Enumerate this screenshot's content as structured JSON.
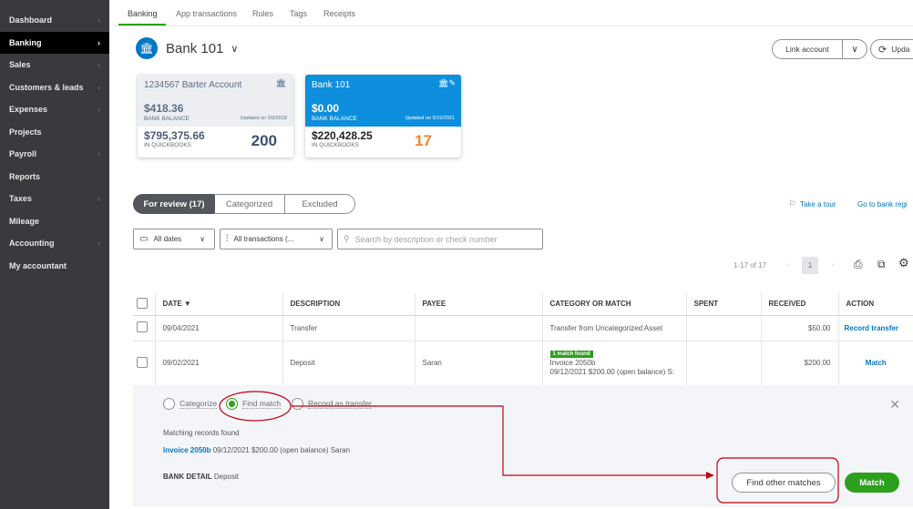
{
  "sidebar": {
    "items": [
      {
        "label": "Dashboard",
        "chevron": true
      },
      {
        "label": "Banking",
        "chevron": true,
        "active": true
      },
      {
        "label": "Sales",
        "chevron": true
      },
      {
        "label": "Customers & leads",
        "chevron": true
      },
      {
        "label": "Expenses",
        "chevron": true
      },
      {
        "label": "Projects",
        "chevron": false
      },
      {
        "label": "Payroll",
        "chevron": true
      },
      {
        "label": "Reports",
        "chevron": false
      },
      {
        "label": "Taxes",
        "chevron": true
      },
      {
        "label": "Mileage",
        "chevron": false
      },
      {
        "label": "Accounting",
        "chevron": true
      },
      {
        "label": "My accountant",
        "chevron": false
      }
    ]
  },
  "tabs": [
    "Banking",
    "App transactions",
    "Rules",
    "Tags",
    "Receipts"
  ],
  "account": {
    "name": "Bank 101"
  },
  "header_buttons": {
    "link_account": "Link account",
    "update": "Upda"
  },
  "cards": [
    {
      "name": "1234567 Barter Account",
      "bank_balance": "$418.36",
      "bank_balance_label": "BANK BALANCE",
      "updated": "Updated on 3/3/2018",
      "qb_balance": "$795,375.66",
      "qb_label": "IN QUICKBOOKS",
      "count": "200"
    },
    {
      "name": "Bank 101",
      "bank_balance": "$0.00",
      "bank_balance_label": "BANK BALANCE",
      "updated": "Updated on 9/19/2021",
      "qb_balance": "$220,428.25",
      "qb_label": "IN QUICKBOOKS",
      "count": "17"
    }
  ],
  "review_tabs": [
    "For review (17)",
    "Categorized",
    "Excluded"
  ],
  "links": {
    "tour": "Take a tour",
    "register": "Go to bank regi"
  },
  "filters": {
    "dates": "All dates",
    "transactions": "All transactions (...",
    "search_placeholder": "Search by description or check number"
  },
  "pagination": {
    "range": "1-17 of 17",
    "page": "1"
  },
  "table": {
    "headers": [
      "DATE ▼",
      "DESCRIPTION",
      "PAYEE",
      "CATEGORY OR MATCH",
      "SPENT",
      "RECEIVED",
      "ACTION"
    ],
    "rows": [
      {
        "date": "09/04/2021",
        "description": "Transfer",
        "payee": "",
        "category": "Transfer from Uncategorized Asset",
        "spent": "",
        "received": "$50.00",
        "action": "Record transfer"
      },
      {
        "date": "09/02/2021",
        "description": "Deposit",
        "payee": "Saran",
        "badge": "1 match found",
        "category_line1": "Invoice 2050b",
        "category_line2": "09/12/2021 $200.00 (open balance) S:",
        "spent": "",
        "received": "$200.00",
        "action": "Match"
      }
    ]
  },
  "panel": {
    "radios": [
      "Categorize",
      "Find match",
      "Record as transfer"
    ],
    "matching_title": "Matching records found",
    "match_link": "Invoice 2050b",
    "match_detail": "09/12/2021 $200.00 (open balance) Saran",
    "bank_detail_label": "BANK DETAIL",
    "bank_detail_value": "Deposit",
    "find_other": "Find other matches",
    "match_button": "Match"
  },
  "colors": {
    "green": "#2ca01c",
    "blue": "#0077c5",
    "card_blue": "#0d8fdd",
    "annotation": "#c0000f"
  }
}
